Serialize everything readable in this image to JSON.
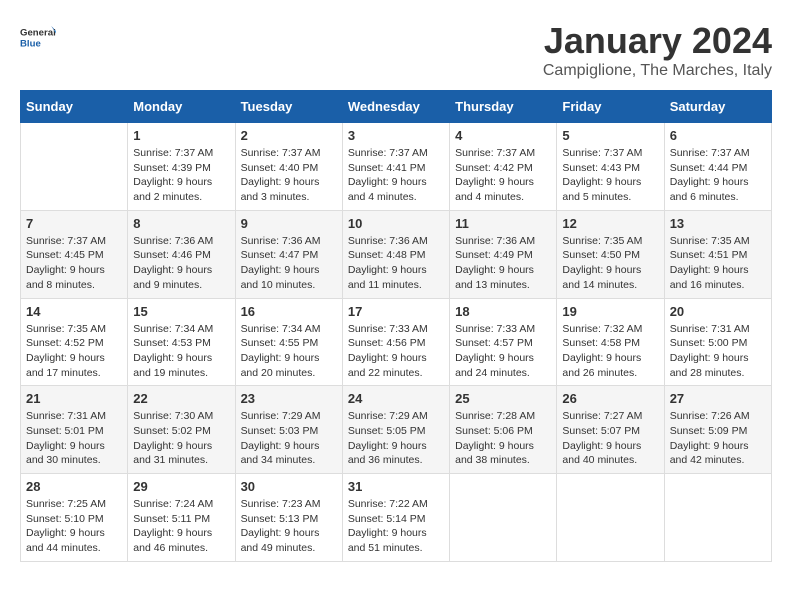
{
  "logo": {
    "text_general": "General",
    "text_blue": "Blue"
  },
  "header": {
    "month": "January 2024",
    "location": "Campiglione, The Marches, Italy"
  },
  "days_of_week": [
    "Sunday",
    "Monday",
    "Tuesday",
    "Wednesday",
    "Thursday",
    "Friday",
    "Saturday"
  ],
  "weeks": [
    [
      {
        "day": "",
        "info": ""
      },
      {
        "day": "1",
        "info": "Sunrise: 7:37 AM\nSunset: 4:39 PM\nDaylight: 9 hours\nand 2 minutes."
      },
      {
        "day": "2",
        "info": "Sunrise: 7:37 AM\nSunset: 4:40 PM\nDaylight: 9 hours\nand 3 minutes."
      },
      {
        "day": "3",
        "info": "Sunrise: 7:37 AM\nSunset: 4:41 PM\nDaylight: 9 hours\nand 4 minutes."
      },
      {
        "day": "4",
        "info": "Sunrise: 7:37 AM\nSunset: 4:42 PM\nDaylight: 9 hours\nand 4 minutes."
      },
      {
        "day": "5",
        "info": "Sunrise: 7:37 AM\nSunset: 4:43 PM\nDaylight: 9 hours\nand 5 minutes."
      },
      {
        "day": "6",
        "info": "Sunrise: 7:37 AM\nSunset: 4:44 PM\nDaylight: 9 hours\nand 6 minutes."
      }
    ],
    [
      {
        "day": "7",
        "info": "Sunrise: 7:37 AM\nSunset: 4:45 PM\nDaylight: 9 hours\nand 8 minutes."
      },
      {
        "day": "8",
        "info": "Sunrise: 7:36 AM\nSunset: 4:46 PM\nDaylight: 9 hours\nand 9 minutes."
      },
      {
        "day": "9",
        "info": "Sunrise: 7:36 AM\nSunset: 4:47 PM\nDaylight: 9 hours\nand 10 minutes."
      },
      {
        "day": "10",
        "info": "Sunrise: 7:36 AM\nSunset: 4:48 PM\nDaylight: 9 hours\nand 11 minutes."
      },
      {
        "day": "11",
        "info": "Sunrise: 7:36 AM\nSunset: 4:49 PM\nDaylight: 9 hours\nand 13 minutes."
      },
      {
        "day": "12",
        "info": "Sunrise: 7:35 AM\nSunset: 4:50 PM\nDaylight: 9 hours\nand 14 minutes."
      },
      {
        "day": "13",
        "info": "Sunrise: 7:35 AM\nSunset: 4:51 PM\nDaylight: 9 hours\nand 16 minutes."
      }
    ],
    [
      {
        "day": "14",
        "info": "Sunrise: 7:35 AM\nSunset: 4:52 PM\nDaylight: 9 hours\nand 17 minutes."
      },
      {
        "day": "15",
        "info": "Sunrise: 7:34 AM\nSunset: 4:53 PM\nDaylight: 9 hours\nand 19 minutes."
      },
      {
        "day": "16",
        "info": "Sunrise: 7:34 AM\nSunset: 4:55 PM\nDaylight: 9 hours\nand 20 minutes."
      },
      {
        "day": "17",
        "info": "Sunrise: 7:33 AM\nSunset: 4:56 PM\nDaylight: 9 hours\nand 22 minutes."
      },
      {
        "day": "18",
        "info": "Sunrise: 7:33 AM\nSunset: 4:57 PM\nDaylight: 9 hours\nand 24 minutes."
      },
      {
        "day": "19",
        "info": "Sunrise: 7:32 AM\nSunset: 4:58 PM\nDaylight: 9 hours\nand 26 minutes."
      },
      {
        "day": "20",
        "info": "Sunrise: 7:31 AM\nSunset: 5:00 PM\nDaylight: 9 hours\nand 28 minutes."
      }
    ],
    [
      {
        "day": "21",
        "info": "Sunrise: 7:31 AM\nSunset: 5:01 PM\nDaylight: 9 hours\nand 30 minutes."
      },
      {
        "day": "22",
        "info": "Sunrise: 7:30 AM\nSunset: 5:02 PM\nDaylight: 9 hours\nand 31 minutes."
      },
      {
        "day": "23",
        "info": "Sunrise: 7:29 AM\nSunset: 5:03 PM\nDaylight: 9 hours\nand 34 minutes."
      },
      {
        "day": "24",
        "info": "Sunrise: 7:29 AM\nSunset: 5:05 PM\nDaylight: 9 hours\nand 36 minutes."
      },
      {
        "day": "25",
        "info": "Sunrise: 7:28 AM\nSunset: 5:06 PM\nDaylight: 9 hours\nand 38 minutes."
      },
      {
        "day": "26",
        "info": "Sunrise: 7:27 AM\nSunset: 5:07 PM\nDaylight: 9 hours\nand 40 minutes."
      },
      {
        "day": "27",
        "info": "Sunrise: 7:26 AM\nSunset: 5:09 PM\nDaylight: 9 hours\nand 42 minutes."
      }
    ],
    [
      {
        "day": "28",
        "info": "Sunrise: 7:25 AM\nSunset: 5:10 PM\nDaylight: 9 hours\nand 44 minutes."
      },
      {
        "day": "29",
        "info": "Sunrise: 7:24 AM\nSunset: 5:11 PM\nDaylight: 9 hours\nand 46 minutes."
      },
      {
        "day": "30",
        "info": "Sunrise: 7:23 AM\nSunset: 5:13 PM\nDaylight: 9 hours\nand 49 minutes."
      },
      {
        "day": "31",
        "info": "Sunrise: 7:22 AM\nSunset: 5:14 PM\nDaylight: 9 hours\nand 51 minutes."
      },
      {
        "day": "",
        "info": ""
      },
      {
        "day": "",
        "info": ""
      },
      {
        "day": "",
        "info": ""
      }
    ]
  ]
}
